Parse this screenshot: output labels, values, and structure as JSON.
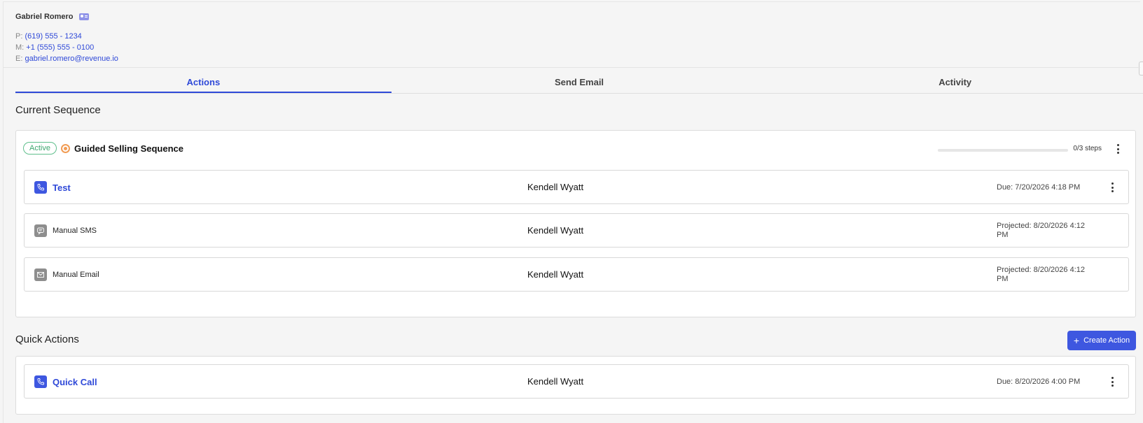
{
  "contact": {
    "name": "Gabriel Romero",
    "phone_key": "P:",
    "phone": "(619) 555 - 1234",
    "mobile_key": "M:",
    "mobile": "+1 (555) 555 - 0100",
    "email_key": "E:",
    "email": "gabriel.romero@revenue.io"
  },
  "tabs": [
    {
      "label": "Actions",
      "active": true
    },
    {
      "label": "Send Email",
      "active": false
    },
    {
      "label": "Activity",
      "active": false
    }
  ],
  "current_sequence": {
    "section_title": "Current Sequence",
    "status_badge": "Active",
    "sequence_name": "Guided Selling Sequence",
    "steps_text": "0/3 steps",
    "progress_fraction": 0,
    "steps": [
      {
        "title": "Test",
        "icon": "phone-icon",
        "owner": "Kendell Wyatt",
        "date_line1": "Due: 7/20/2026 4:18 PM",
        "date_line2": ""
      },
      {
        "title": "Manual SMS",
        "icon": "sms-icon",
        "owner": "Kendell Wyatt",
        "date_line1": "Projected: 8/20/2026 4:12",
        "date_line2": "PM"
      },
      {
        "title": "Manual Email",
        "icon": "email-icon",
        "owner": "Kendell Wyatt",
        "date_line1": "Projected: 8/20/2026 4:12",
        "date_line2": "PM"
      }
    ]
  },
  "quick_actions": {
    "section_title": "Quick Actions",
    "create_button": "Create Action",
    "items": [
      {
        "title": "Quick Call",
        "icon": "phone-icon",
        "owner": "Kendell Wyatt",
        "date_line1": "Due: 8/20/2026 4:00 PM"
      }
    ]
  },
  "colors": {
    "accent": "#3e57e0",
    "link": "#2f49d8",
    "active_badge": "#3fa870",
    "sequence_icon": "#f19c54"
  }
}
